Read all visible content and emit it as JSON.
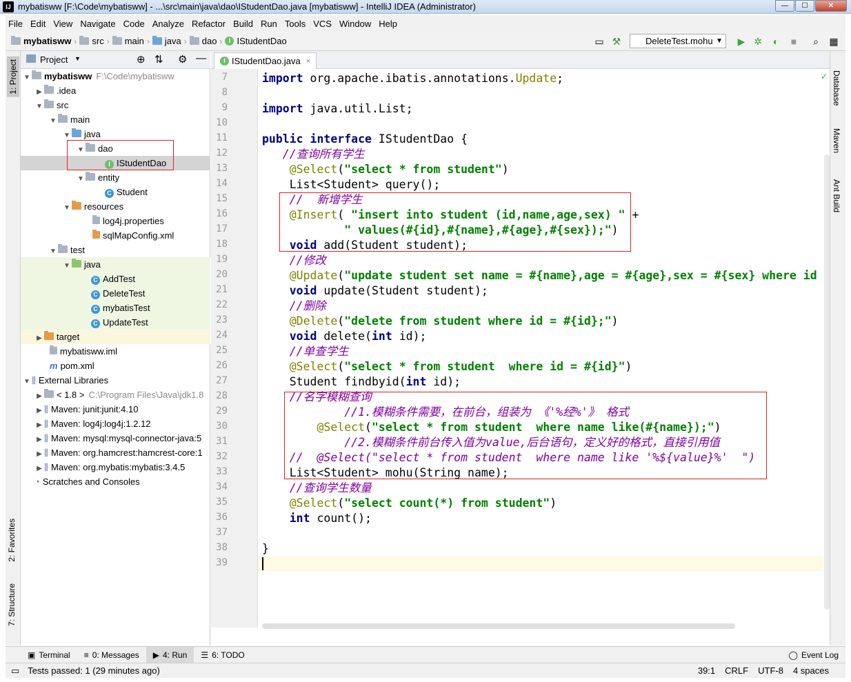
{
  "window": {
    "title": "mybatisww [F:\\Code\\mybatisww] - ...\\src\\main\\java\\dao\\IStudentDao.java [mybatisww] - IntelliJ IDEA (Administrator)",
    "app_icon": "IJ"
  },
  "menu": [
    "File",
    "Edit",
    "View",
    "Navigate",
    "Code",
    "Analyze",
    "Refactor",
    "Build",
    "Run",
    "Tools",
    "VCS",
    "Window",
    "Help"
  ],
  "breadcrumb": [
    "mybatisww",
    "src",
    "main",
    "java",
    "dao",
    "IStudentDao"
  ],
  "run_config": "DeleteTest.mohu",
  "left_tabs": [
    "1: Project",
    "2: Favorites",
    "7: Structure"
  ],
  "right_tabs": [
    "Database",
    "Maven",
    "Ant Build"
  ],
  "project": {
    "header": "Project",
    "tree": [
      {
        "label": "mybatisww",
        "path": "F:\\Code\\mybatisww",
        "bold": true
      },
      {
        "label": ".idea"
      },
      {
        "label": "src"
      },
      {
        "label": "main"
      },
      {
        "label": "java"
      },
      {
        "label": "dao"
      },
      {
        "label": "IStudentDao"
      },
      {
        "label": "entity"
      },
      {
        "label": "Student"
      },
      {
        "label": "resources"
      },
      {
        "label": "log4j.properties"
      },
      {
        "label": "sqlMapConfig.xml"
      },
      {
        "label": "test"
      },
      {
        "label": "java"
      },
      {
        "label": "AddTest"
      },
      {
        "label": "DeleteTest"
      },
      {
        "label": "mybatisTest"
      },
      {
        "label": "UpdateTest"
      },
      {
        "label": "target"
      },
      {
        "label": "mybatisww.iml"
      },
      {
        "label": "pom.xml"
      },
      {
        "label": "External Libraries"
      },
      {
        "label": "< 1.8 >",
        "path": "C:\\Program Files\\Java\\jdk1.8"
      },
      {
        "label": "Maven: junit:junit:4.10"
      },
      {
        "label": "Maven: log4j:log4j:1.2.12"
      },
      {
        "label": "Maven: mysql:mysql-connector-java:5"
      },
      {
        "label": "Maven: org.hamcrest:hamcrest-core:1"
      },
      {
        "label": "Maven: org.mybatis:mybatis:3.4.5"
      },
      {
        "label": "Scratches and Consoles"
      }
    ]
  },
  "editor": {
    "tab": "IStudentDao.java",
    "line_numbers": [
      "7",
      "8",
      "9",
      "10",
      "11",
      "12",
      "13",
      "14",
      "15",
      "16",
      "17",
      "18",
      "19",
      "20",
      "21",
      "22",
      "23",
      "24",
      "25",
      "26",
      "27",
      "28",
      "29",
      "30",
      "31",
      "32",
      "33",
      "34",
      "35",
      "36",
      "37",
      "38",
      "39"
    ],
    "code": {
      "l7a": "import ",
      "l7b": "org.apache.ibatis.annotations.",
      "l7c": "Update",
      "l7d": ";",
      "l9a": "import ",
      "l9b": "java.util.List;",
      "l11a": "public interface ",
      "l11b": "IStudentDao {",
      "l12": "   //查询所有学生",
      "l13a": "    @Select",
      "l13b": "(",
      "l13c": "\"select * from student\"",
      "l13d": ")",
      "l14": "    List<Student> query();",
      "l15": "    //  新增学生",
      "l16a": "    @Insert",
      "l16b": "( ",
      "l16c": "\"insert into student (id,name,age,sex) \"",
      "l16d": " +",
      "l17a": "            ",
      "l17b": "\" values(#{id},#{name},#{age},#{sex});\"",
      "l17c": ")",
      "l18a": "    void ",
      "l18b": "add(Student student);",
      "l19": "    //修改",
      "l20a": "    @Update",
      "l20b": "(",
      "l20c": "\"update student set name = #{name},age = #{age},sex = #{sex} where id =",
      "l21a": "    void ",
      "l21b": "update(Student student);",
      "l22": "    //删除",
      "l23a": "    @Delete",
      "l23b": "(",
      "l23c": "\"delete from student where id = #{id};\"",
      "l23d": ")",
      "l24a": "    void ",
      "l24b": "delete(",
      "l24c": "int ",
      "l24d": "id);",
      "l25": "    //单查学生",
      "l26a": "    @Select",
      "l26b": "(",
      "l26c": "\"select * from student  where id = #{id}\"",
      "l26d": ")",
      "l27a": "    Student findbyid(",
      "l27b": "int ",
      "l27c": "id);",
      "l28": "    //名字模糊查询",
      "l29": "            //1.模糊条件需要，在前台，组装为 《'%经%'》 格式",
      "l30a": "        @Select",
      "l30b": "(",
      "l30c": "\"select * from student  where name like(#{name});\"",
      "l30d": ")",
      "l31": "            //2.模糊条件前台传入值为value,后台语句，定义好的格式，直接引用值",
      "l32": "    //  @Select(\"select * from student  where name like '%${value}%'  \")",
      "l33": "    List<Student> mohu(String name);",
      "l34": "    //查询学生数量",
      "l35a": "    @Select",
      "l35b": "(",
      "l35c": "\"select count(*) from student\"",
      "l35d": ")",
      "l36a": "    int ",
      "l36b": "count();",
      "l38": "}"
    }
  },
  "bottom_tabs": [
    "Terminal",
    "0: Messages",
    "4: Run",
    "6: TODO"
  ],
  "event_log": "Event Log",
  "status": {
    "message": "Tests passed: 1 (29 minutes ago)",
    "position": "39:1",
    "line_sep": "CRLF",
    "encoding": "UTF-8",
    "indent": "4 spaces"
  }
}
